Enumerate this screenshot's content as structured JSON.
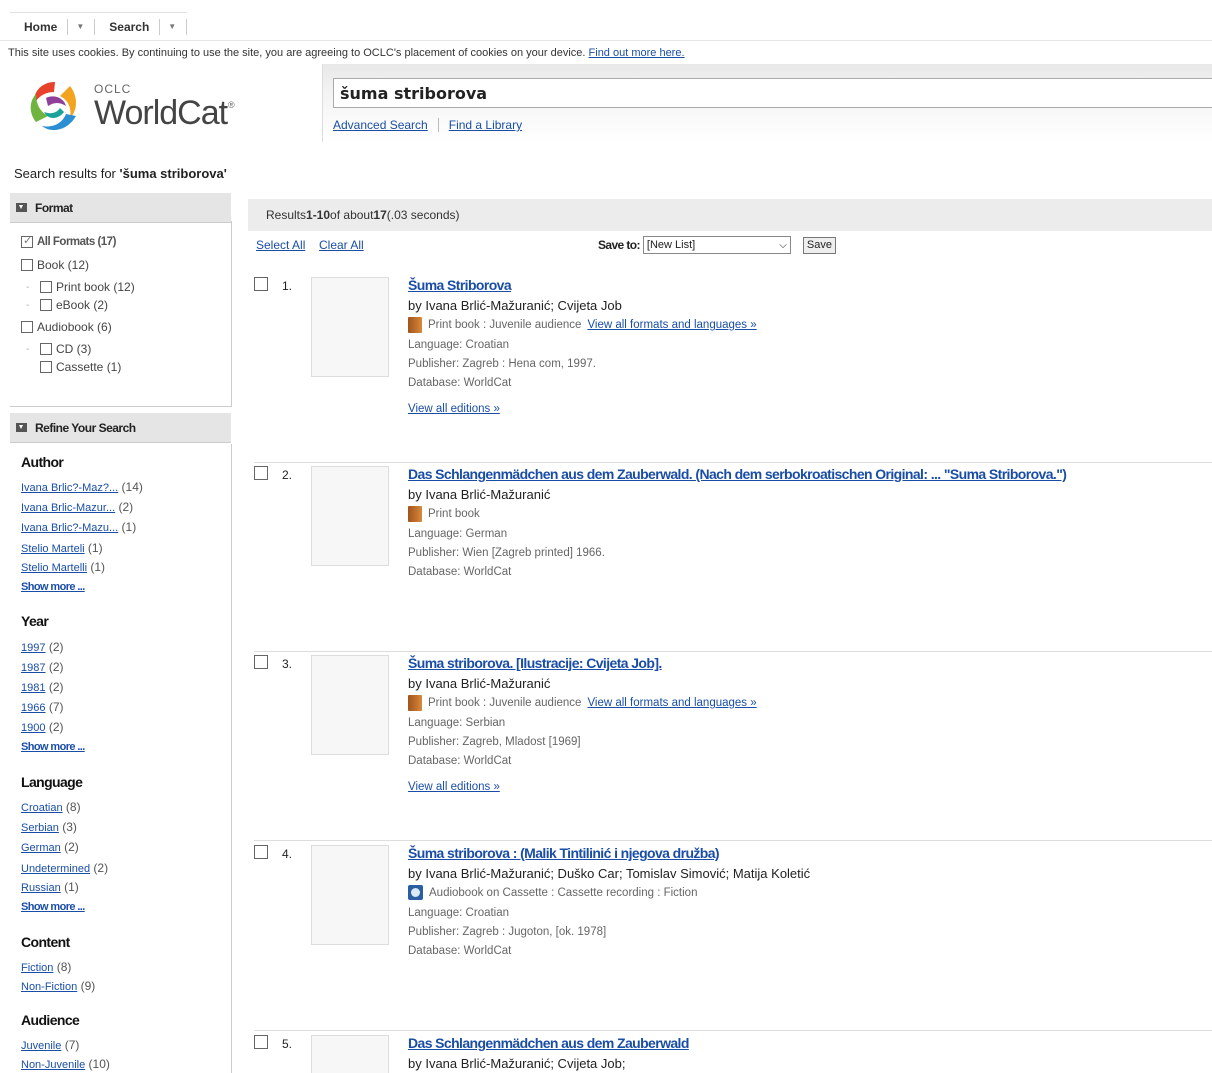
{
  "nav": {
    "home": "Home",
    "search": "Search"
  },
  "cookie": {
    "text": "This site uses cookies. By continuing to use the site, you are agreeing to OCLC's placement of cookies on your device. ",
    "link": "Find out more here."
  },
  "logo": {
    "oclc": "OCLC",
    "worldcat": "WorldCat",
    "tm": "®"
  },
  "search": {
    "value": "šuma striborova",
    "advanced": "Advanced Search",
    "find_library": "Find a Library"
  },
  "results_for": {
    "prefix": "Search results for ",
    "query": "'šuma striborova'"
  },
  "format": {
    "header": "Format",
    "items": [
      {
        "label": "All Formats (17)",
        "checked": true
      },
      {
        "label": "Book (12)"
      },
      {
        "label": "Print book (12)"
      },
      {
        "label": "eBook (2)"
      },
      {
        "label": "Audiobook (6)"
      },
      {
        "label": "CD (3)"
      },
      {
        "label": "Cassette (1)"
      }
    ]
  },
  "refine": {
    "header": "Refine Your Search",
    "author": {
      "title": "Author",
      "items": [
        {
          "link": "Ivana Brlic?-Maz?...",
          "count": " (14)"
        },
        {
          "link": "Ivana Brlic-Mazur...",
          "count": " (2)"
        },
        {
          "link": "Ivana Brlic?-Mazu...",
          "count": " (1)"
        },
        {
          "link": "Stelio Marteli",
          "count": " (1)"
        },
        {
          "link": "Stelio Martelli",
          "count": " (1)"
        }
      ]
    },
    "year": {
      "title": "Year",
      "items": [
        {
          "link": "1997",
          "count": " (2)"
        },
        {
          "link": "1987",
          "count": " (2)"
        },
        {
          "link": "1981",
          "count": " (2)"
        },
        {
          "link": "1966",
          "count": " (7)"
        },
        {
          "link": "1900",
          "count": " (2)"
        }
      ]
    },
    "language": {
      "title": "Language",
      "items": [
        {
          "link": "Croatian",
          "count": " (8)"
        },
        {
          "link": "Serbian",
          "count": " (3)"
        },
        {
          "link": "German",
          "count": " (2)"
        },
        {
          "link": "Undetermined",
          "count": " (2)"
        },
        {
          "link": "Russian",
          "count": " (1)"
        }
      ]
    },
    "content": {
      "title": "Content",
      "items": [
        {
          "link": "Fiction",
          "count": " (8)"
        },
        {
          "link": "Non-Fiction",
          "count": " (9)"
        }
      ]
    },
    "audience": {
      "title": "Audience",
      "items": [
        {
          "link": "Juvenile",
          "count": " (7)"
        },
        {
          "link": "Non-Juvenile",
          "count": " (10)"
        }
      ]
    },
    "show_more": "Show more ..."
  },
  "results_bar": {
    "prefix": "Results ",
    "range": "1-10",
    "mid": " of about ",
    "total": "17",
    "suffix": " (.03 seconds)"
  },
  "toolbar": {
    "select_all": "Select All",
    "clear_all": "Clear All",
    "save_to": "Save to:",
    "list": "[New List]",
    "save": "Save"
  },
  "results": [
    {
      "num": "1.",
      "title": "Šuma Striborova",
      "author": "by Ivana Brlić-Mažuranić; Cvijeta Job",
      "format": "Print book : Juvenile audience",
      "view_formats": "View all formats and languages »",
      "language": "Language: Croatian",
      "publisher": "Publisher: Zagreb : Hena com, 1997.",
      "database": "Database: WorldCat",
      "editions": "View all editions »"
    },
    {
      "num": "2.",
      "title": "Das Schlangenmädchen aus dem Zauberwald. (Nach dem serbokroatischen Original: ... \"Suma Striborova.\")",
      "author": "by Ivana Brlić-Mažuranić",
      "format": "Print book",
      "language": "Language: German",
      "publisher": "Publisher: Wien [Zagreb printed] 1966.",
      "database": "Database: WorldCat"
    },
    {
      "num": "3.",
      "title": "Šuma striborova. [Ilustracije: Cvijeta Job].",
      "author": "by Ivana Brlić-Mažuranić",
      "format": "Print book : Juvenile audience",
      "view_formats": "View all formats and languages »",
      "language": "Language: Serbian",
      "publisher": "Publisher: Zagreb, Mladost [1969]",
      "database": "Database: WorldCat",
      "editions": "View all editions »"
    },
    {
      "num": "4.",
      "title": "Šuma striborova : (Malik Tintilinić i njegova družba)",
      "author": "by Ivana Brlić-Mažuranić; Duško Car; Tomislav Simović; Matija Koletić",
      "format": "Audiobook on Cassette : Cassette recording : Fiction",
      "language": "Language: Croatian",
      "publisher": "Publisher: Zagreb : Jugoton, [ok. 1978]",
      "database": "Database: WorldCat"
    },
    {
      "num": "5.",
      "title": "Das Schlangenmädchen aus dem Zauberwald",
      "author": "by Ivana Brlić-Mažuranić; Cvijeta Job;"
    }
  ]
}
